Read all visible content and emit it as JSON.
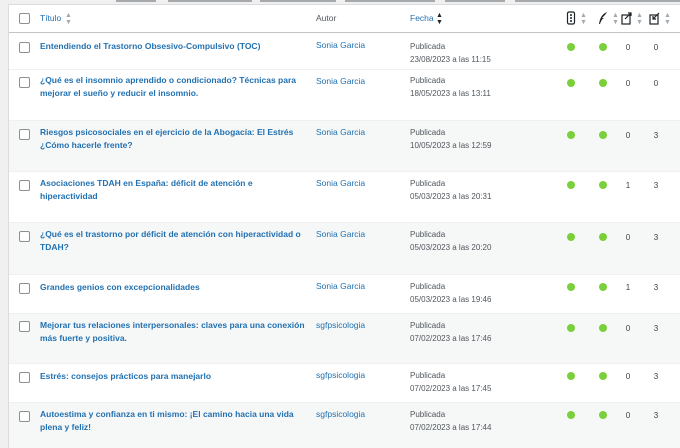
{
  "columns": {
    "title": "Título",
    "author": "Autor",
    "date": "Fecha"
  },
  "header_icons": [
    "seo-score-icon",
    "readability-icon",
    "outgoing-links-icon",
    "incoming-links-icon"
  ],
  "posts": [
    {
      "title": "Entendiendo el Trastorno Obsesivo-Compulsivo (TOC)",
      "author": "Sonia Garcia",
      "status": "Publicada",
      "date": "23/08/2023 a las 11:15",
      "links_out": "0",
      "links_in": "0"
    },
    {
      "title": "¿Qué es el insomnio aprendido o condicionado? Técnicas para mejorar el sueño y reducir el insomnio.",
      "author": "Sonia Garcia",
      "status": "Publicada",
      "date": "18/05/2023 a las 13:11",
      "links_out": "0",
      "links_in": "0"
    },
    {
      "title": "Riesgos psicosociales en el ejercicio de la Abogacía: El Estrés ¿Cómo hacerle frente?",
      "author": "Sonia Garcia",
      "status": "Publicada",
      "date": "10/05/2023 a las 12:59",
      "links_out": "0",
      "links_in": "3"
    },
    {
      "title": "Asociaciones TDAH en España: déficit de atención e hiperactividad",
      "author": "Sonia Garcia",
      "status": "Publicada",
      "date": "05/03/2023 a las 20:31",
      "links_out": "1",
      "links_in": "3"
    },
    {
      "title": "¿Qué es el trastorno por déficit de atención con hiperactividad o TDAH?",
      "author": "Sonia Garcia",
      "status": "Publicada",
      "date": "05/03/2023 a las 20:20",
      "links_out": "0",
      "links_in": "3"
    },
    {
      "title": "Grandes genios con excepcionalidades",
      "author": "Sonia Garcia",
      "status": "Publicada",
      "date": "05/03/2023 a las 19:46",
      "links_out": "1",
      "links_in": "3"
    },
    {
      "title": "Mejorar tus relaciones interpersonales: claves para una conexión más fuerte y positiva.",
      "author": "sgfpsicologia",
      "status": "Publicada",
      "date": "07/02/2023 a las 17:46",
      "links_out": "0",
      "links_in": "3"
    },
    {
      "title": "Estrés: consejos prácticos para manejarlo",
      "author": "sgfpsicologia",
      "status": "Publicada",
      "date": "07/02/2023 a las 17:45",
      "links_out": "0",
      "links_in": "3"
    },
    {
      "title": "Autoestima y confianza en ti mismo: ¡El camino hacia una vida plena y feliz!",
      "author": "sgfpsicologia",
      "status": "Publicada",
      "date": "07/02/2023 a las 17:44",
      "links_out": "0",
      "links_in": "3"
    }
  ],
  "colors": {
    "link": "#2271b1",
    "seo_good": "#7ad03a"
  }
}
